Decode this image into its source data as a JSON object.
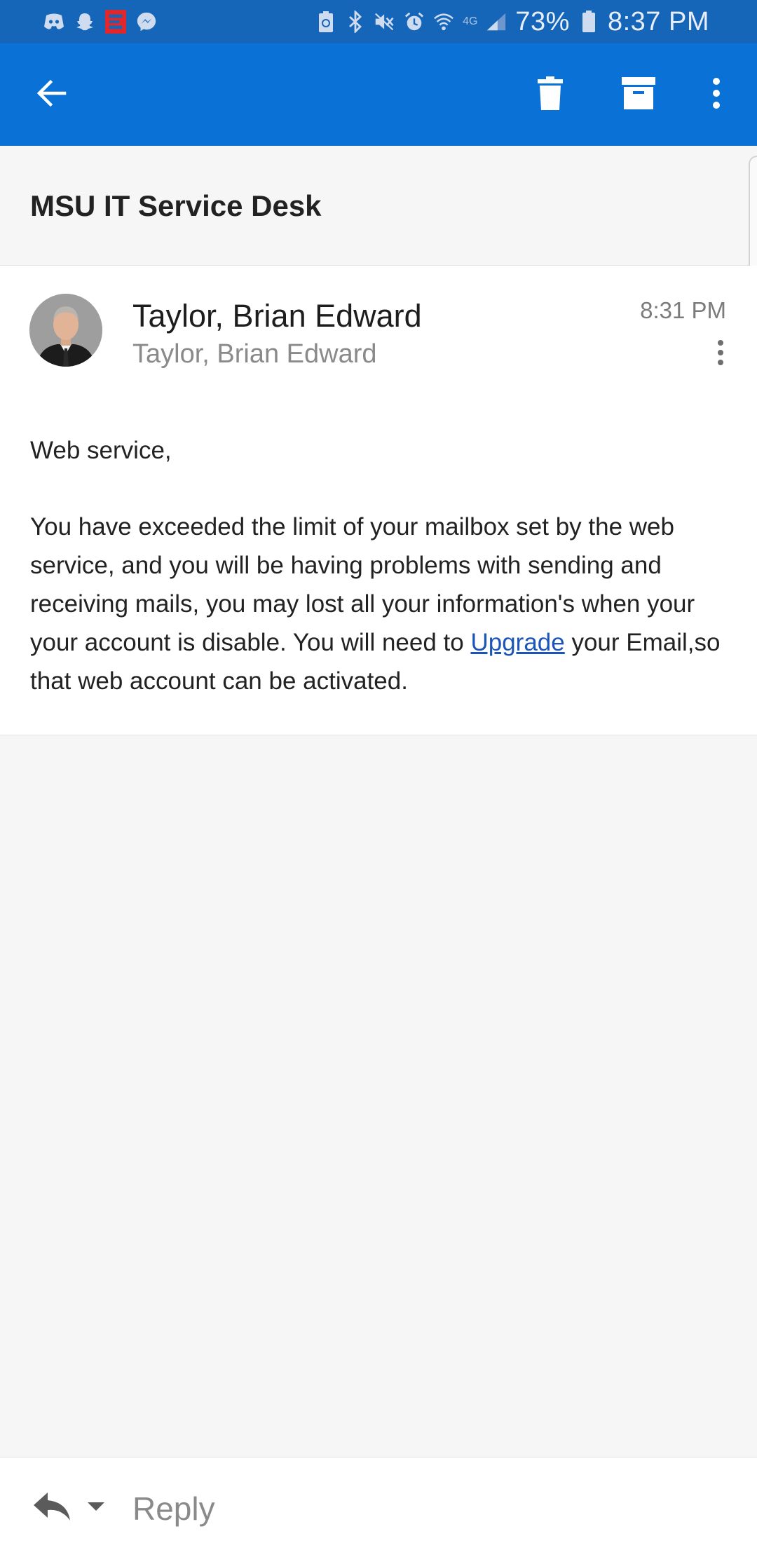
{
  "status_bar": {
    "battery": "73%",
    "time": "8:37 PM",
    "network": "4G",
    "icons": [
      "discord-icon",
      "snapchat-icon",
      "espn-icon",
      "messenger-icon",
      "battery-saver-icon",
      "bluetooth-icon",
      "mute-icon",
      "alarm-icon",
      "wifi-icon",
      "signal-icon",
      "battery-icon"
    ]
  },
  "app_bar": {
    "icons": [
      "back-arrow-icon",
      "delete-icon",
      "archive-icon",
      "more-vert-icon"
    ]
  },
  "email": {
    "subject": "MSU IT Service Desk",
    "sender_name": "Taylor, Brian Edward",
    "sender_secondary": "Taylor, Brian Edward",
    "time": "8:31 PM",
    "greeting": "Web service,",
    "body_before_link": "You have exceeded the limit of your mailbox set by the web service, and you will be having problems with sending and receiving mails, you may lost all your information's when your your account is disable. You will need to ",
    "link_text": "Upgrade",
    "body_after_link": " your Email,so that web account can be activated."
  },
  "reply_bar": {
    "label": "Reply",
    "icons": [
      "reply-icon",
      "chevron-down-icon"
    ]
  },
  "colors": {
    "status_bar": "#1565b8",
    "app_bar": "#0a72d6",
    "link": "#1c55b8",
    "background": "#f6f6f6"
  }
}
